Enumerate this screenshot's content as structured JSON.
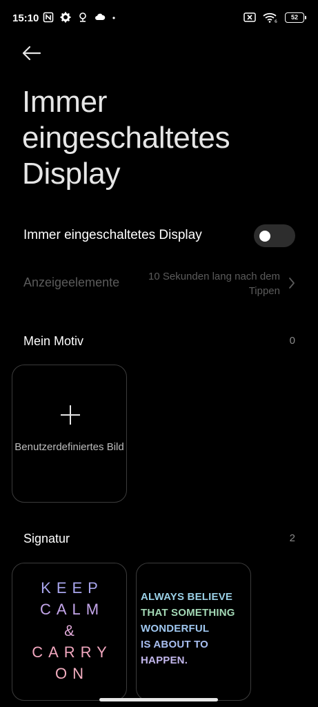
{
  "status_bar": {
    "time": "15:10",
    "battery": "52",
    "icons_left": [
      "nfc-icon",
      "settings-icon",
      "location-icon",
      "cloud-icon",
      "dot-icon"
    ],
    "icons_right": [
      "sim-off-icon",
      "wifi-icon",
      "battery-icon"
    ]
  },
  "header": {
    "back_icon": "arrow-left-icon",
    "title": "Immer eingeschaltetes Display"
  },
  "settings": {
    "toggle_label": "Immer eingeschaltetes Display",
    "toggle_on": false,
    "elements_label": "Anzeigeelemente",
    "elements_value": "10 Sekunden lang nach dem Tippen"
  },
  "mein_motiv": {
    "title": "Mein Motiv",
    "count": "0",
    "add_card_label": "Benutzerdefiniertes Bild"
  },
  "signatur": {
    "title": "Signatur",
    "count": "2",
    "cards": [
      {
        "lines": [
          "KEEP",
          "CALM",
          "&",
          "CARRY",
          "ON"
        ]
      },
      {
        "lines": [
          "ALWAYS BELIEVE",
          "THAT SOMETHING",
          "WONDERFUL",
          "IS ABOUT TO",
          "HAPPEN."
        ]
      }
    ]
  },
  "colors": {
    "background": "#000000",
    "secondary_text": "#5b5b5b",
    "card_border": "#3c3c3c",
    "toggle_track": "#2d2d2d"
  }
}
